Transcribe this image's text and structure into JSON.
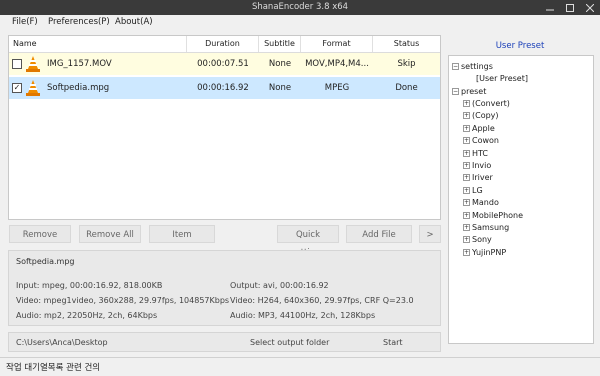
{
  "window": {
    "title": "ShanaEncoder 3.8 x64"
  },
  "menu": [
    "File(F)",
    "Preferences(P)",
    "About(A)"
  ],
  "columns": [
    "Name",
    "Duration",
    "Subtitle",
    "Format",
    "Status"
  ],
  "files": [
    {
      "checked": false,
      "name": "IMG_1157.MOV",
      "duration": "00:00:07.51",
      "subtitle": "None",
      "format": "MOV,MP4,M4...",
      "status": "Skip"
    },
    {
      "checked": true,
      "name": "Softpedia.mpg",
      "duration": "00:00:16.92",
      "subtitle": "None",
      "format": "MPEG",
      "status": "Done"
    }
  ],
  "preset_panel": {
    "title": "User Preset",
    "settings_label": "settings",
    "user_preset": "[User Preset]",
    "preset_label": "preset",
    "presets": [
      "(Convert)",
      "(Copy)",
      "Apple",
      "Cowon",
      "HTC",
      "Invio",
      "Iriver",
      "LG",
      "Mando",
      "MobilePhone",
      "Samsung",
      "Sony",
      "YujinPNP"
    ]
  },
  "buttons": {
    "remove": "Remove",
    "remove_all": "Remove All",
    "item": "Item",
    "quick_settings": "Quick settings",
    "add_file": "Add File",
    "more": ">"
  },
  "info": {
    "filename": "Softpedia.mpg",
    "input": "Input: mpeg, 00:00:16.92, 818.00KB",
    "input_video": "Video: mpeg1video, 360x288, 29.97fps, 104857Kbps",
    "input_audio": "Audio: mp2, 22050Hz, 2ch, 64Kbps",
    "output": "Output: avi, 00:00:16.92",
    "output_video": "Video: H264, 640x360, 29.97fps, CRF Q=23.0",
    "output_audio": "Audio: MP3, 44100Hz, 2ch, 128Kbps"
  },
  "bottom": {
    "output_path": "C:\\Users\\Anca\\Desktop",
    "select_folder": "Select output folder",
    "start": "Start"
  },
  "status": "작업 대기열목록 관련 건의",
  "colors": {
    "titlebar": "#3a3a3a",
    "row_skip": "#fffde0",
    "row_done": "#cde8ff",
    "accent": "#1a3fb8"
  }
}
